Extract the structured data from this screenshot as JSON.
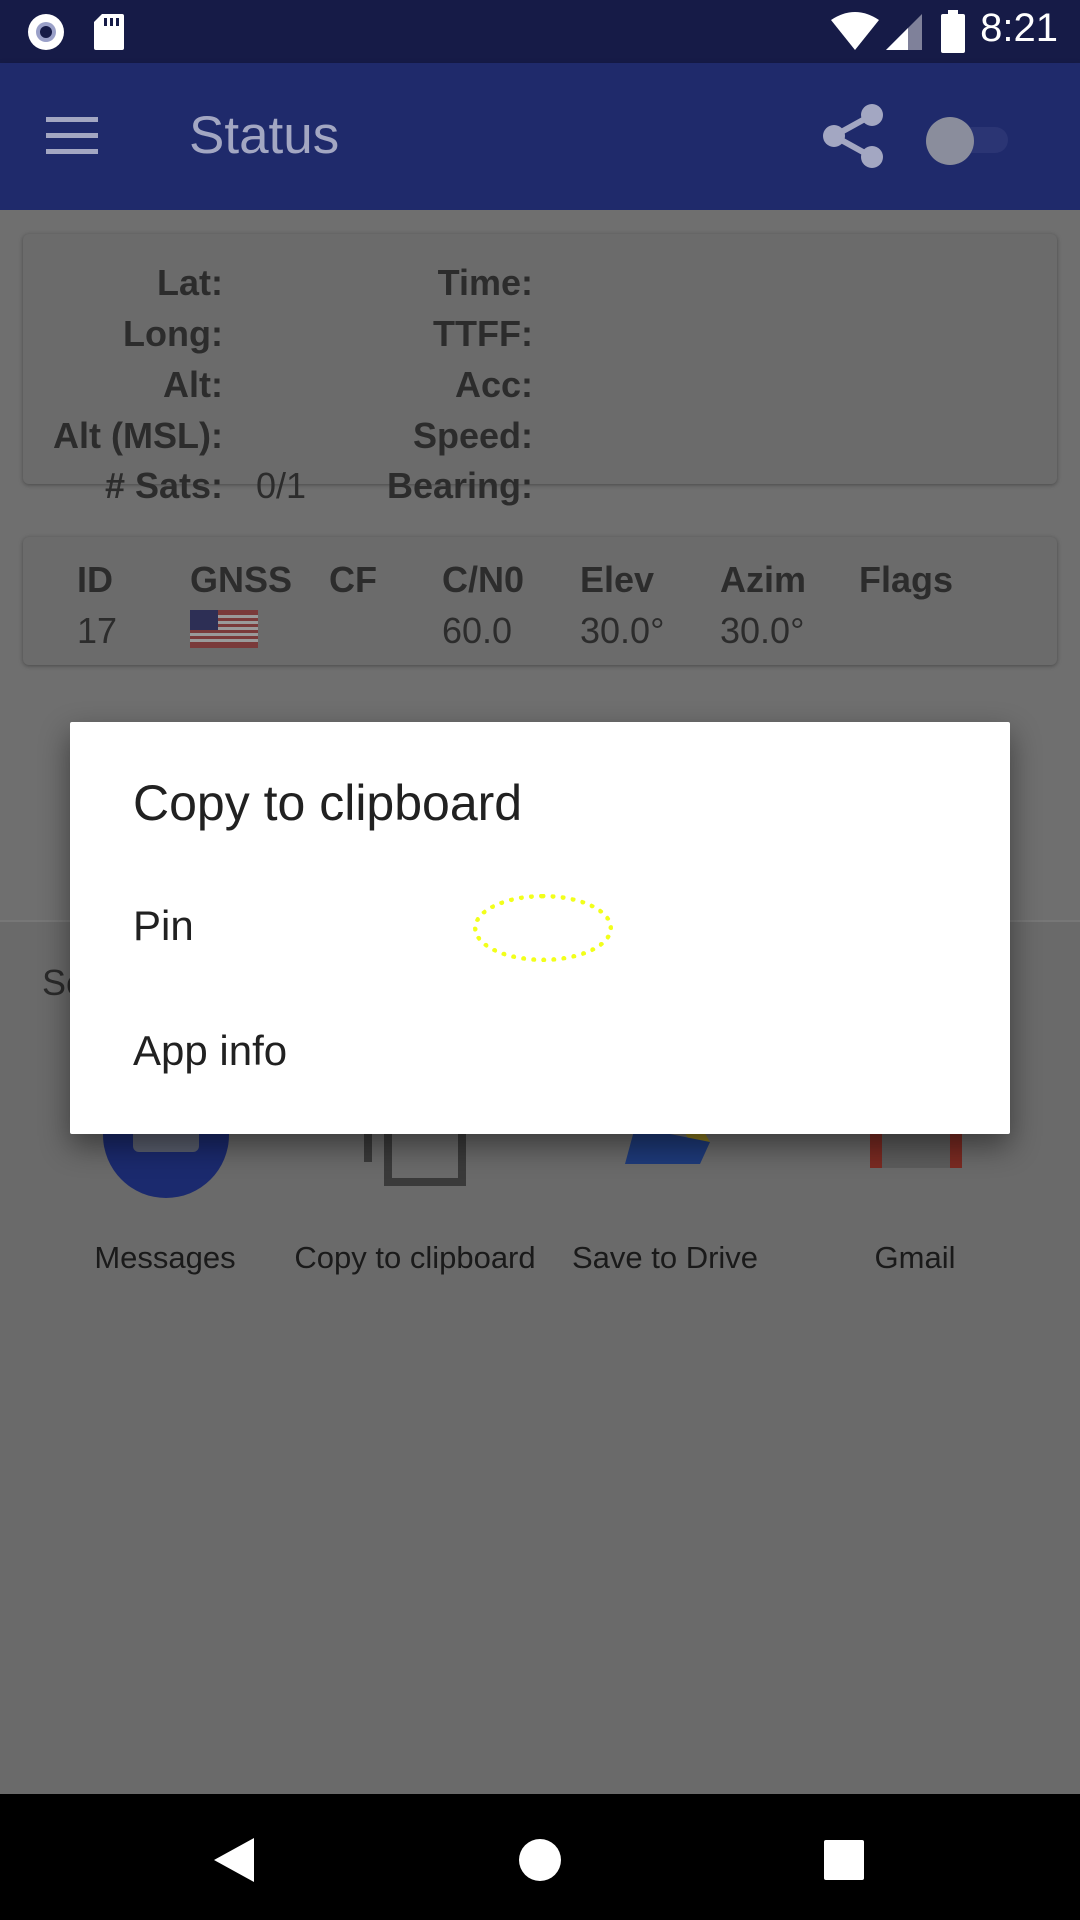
{
  "status_bar": {
    "time": "8:21",
    "icons": [
      "record-icon",
      "sd-card-icon",
      "wifi-icon",
      "signal-icon",
      "battery-icon"
    ]
  },
  "app_bar": {
    "title": "Status",
    "menu_icon": "hamburger-menu-icon",
    "share_icon": "share-icon",
    "toggle_state": "off"
  },
  "location_card": {
    "left_labels": [
      "Lat:",
      "Long:",
      "Alt:",
      "Alt (MSL):",
      "# Sats:"
    ],
    "sats_value": "0/1",
    "right_labels": [
      "Time:",
      "TTFF:",
      "Acc:",
      "Speed:",
      "Bearing:"
    ]
  },
  "satellite_table": {
    "headers": [
      "ID",
      "GNSS",
      "CF",
      "C/N0",
      "Elev",
      "Azim",
      "Flags"
    ],
    "rows": [
      {
        "id": "17",
        "gnss": "us-flag-icon",
        "cf": "",
        "cn0": "60.0",
        "elev": "30.0°",
        "azim": "30.0°",
        "flags": ""
      }
    ]
  },
  "share_sheet": {
    "title_partial": "Se",
    "targets": [
      {
        "label": "Messages",
        "icon": "messages-app-icon"
      },
      {
        "label": "Copy to clipboard",
        "icon": "clipboard-icon"
      },
      {
        "label": "Save to Drive",
        "icon": "google-drive-icon"
      },
      {
        "label": "Gmail",
        "icon": "gmail-icon"
      }
    ]
  },
  "dialog": {
    "title": "Copy to clipboard",
    "items": [
      "Pin",
      "App info"
    ]
  },
  "colors": {
    "status_bar": "#161b47",
    "app_bar": "#1f2a6b",
    "scrim": "#6b6b6b",
    "tap_indicator": "#f2ff1a"
  }
}
